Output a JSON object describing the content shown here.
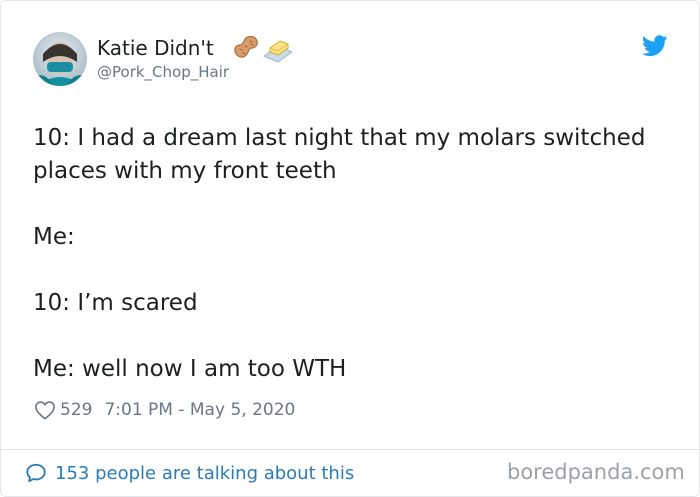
{
  "tweet": {
    "display_name": "Katie Didn't",
    "handle": "@Pork_Chop_Hair",
    "name_emojis": [
      "peanut-emoji",
      "butter-emoji"
    ],
    "lines": [
      "10: I had a dream last night that my molars switched places with my front teeth",
      "Me:",
      "10: I’m scared",
      "Me: well now I am too WTH"
    ],
    "like_count": "529",
    "timestamp": "7:01 PM - May 5, 2020"
  },
  "footer": {
    "conversation_text": "153 people are talking about this",
    "watermark": "boredpanda.com"
  },
  "colors": {
    "twitter_blue": "#1da1f2",
    "link_blue": "#2b7bb9",
    "text": "#1c2022",
    "muted": "#697882",
    "border": "#e1e8ed"
  }
}
